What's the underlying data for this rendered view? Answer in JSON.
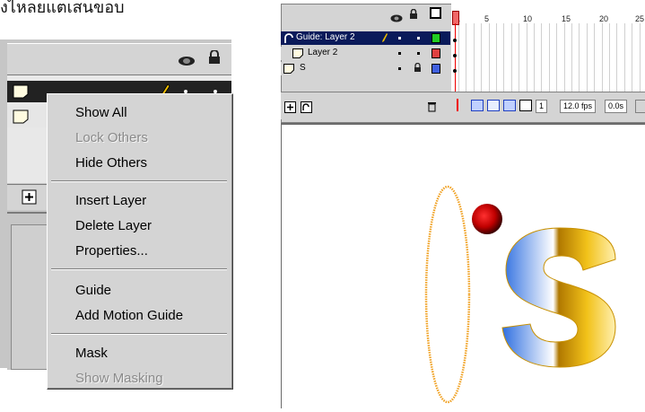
{
  "top_text": "งไหลยแตเสนขอบ",
  "context_menu": {
    "items": [
      {
        "label": "Show All",
        "disabled": false
      },
      {
        "label": "Lock Others",
        "disabled": true
      },
      {
        "label": "Hide Others",
        "disabled": false
      },
      {
        "label": "Insert Layer",
        "disabled": false
      },
      {
        "label": "Delete Layer",
        "disabled": false
      },
      {
        "label": "Properties...",
        "disabled": false
      },
      {
        "label": "Guide",
        "disabled": false
      },
      {
        "label": "Add Motion Guide",
        "disabled": false
      },
      {
        "label": "Mask",
        "disabled": false
      },
      {
        "label": "Show Masking",
        "disabled": true
      }
    ]
  },
  "timeline": {
    "layers": [
      {
        "name": "Guide: Layer 2",
        "color": "#22cc22",
        "selected": true
      },
      {
        "name": "Layer 2",
        "color": "#e04040",
        "selected": false
      },
      {
        "name": "S",
        "color": "#4060e0",
        "selected": false
      }
    ],
    "frame_numbers": [
      "1",
      "5",
      "10",
      "15",
      "20",
      "25"
    ],
    "current_frame": "1",
    "fps": "12.0 fps",
    "time": "0.0s"
  },
  "colors": {
    "panel": "#d4d4d4",
    "selected_row": "#222222",
    "ball": "#cc0000",
    "ellipse": "#f0a020"
  }
}
